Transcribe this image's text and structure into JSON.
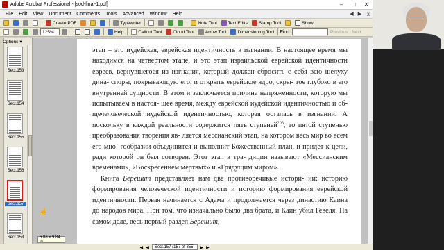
{
  "window": {
    "title": "Adobe Acrobat Professional - [sod-final-1.pdf]",
    "minimize": "–",
    "maximize": "□",
    "close": "✕"
  },
  "menubar": {
    "items": [
      "File",
      "Edit",
      "View",
      "Document",
      "Comments",
      "Tools",
      "Advanced",
      "Window",
      "Help"
    ],
    "close": "x"
  },
  "toolbar1": {
    "create_pdf": "Create PDF",
    "typewriter": "Typewriter",
    "note_tool": "Note Tool",
    "text_edits": "Text Edits",
    "stamp_tool": "Stamp Tool",
    "show": "Show"
  },
  "toolbar2": {
    "zoom": "125%",
    "help": "Help",
    "callout_tool": "Callout Tool",
    "cloud_tool": "Cloud Tool",
    "arrow_tool": "Arrow Tool",
    "dimensioning_tool": "Dimensioning Tool",
    "find_label": "Find:",
    "previous": "Previous",
    "next": "Next"
  },
  "sidebar": {
    "options": "Options",
    "thumbnails": [
      {
        "label": "Sect.153",
        "selected": false
      },
      {
        "label": "Sect.154",
        "selected": false
      },
      {
        "label": "Sect.155",
        "selected": false
      },
      {
        "label": "Sect.156",
        "selected": false
      },
      {
        "label": "Sect.157",
        "selected": true
      },
      {
        "label": "Sect.158",
        "selected": false
      }
    ]
  },
  "document": {
    "paragraph1": [
      "этап – это иудейская, еврейская идентичность в изгнании. В",
      "настоящее время мы находимся на четвертом этапе, и это этап",
      "израильской еврейской идентичности евреев, вернувшегося из",
      "изгнания, который должен сбросить с себя всю шелуху дина-",
      "споры, покрывающую его, и открыть еврейское ядро, скры-",
      "тое глубоко в его внутренней сущности. В этом и заключается",
      "причина напряженности, которую мы испытываем в настоя-",
      "щее время, между еврейской иудейской идентичностью и об-",
      "щечеловеческой иудейской идентичностью, которая осталась",
      "в изгнании. А поскольку в каждой реальности содержится пять"
    ],
    "p1_line11_before": "ступеней",
    "footnote_ref": "206",
    "p1_line11_after": ", то пятой ступенью преобразования творения яв-",
    "paragraph1_tail": [
      "ляется мессианский этап, на котором весь мир во всем его мно-",
      "гообразии объединится и выполнит Божественный план, и",
      "придет к цели, ради которой он был сотворен. Этот этап в тра-",
      "диции называют «Мессианским временами», «Воскресением",
      "мертвых» и «Грядущим миром»."
    ],
    "p2_line1_before": "Книга ",
    "p2_line1_italic": "Берешит",
    "p2_line1_after": " представляет нам две противоречивые истори-",
    "paragraph2": [
      "ии: историю формирования человеческой идентичности и",
      "историю формирования еврейской идентичности. Первая",
      "начинается с Адама и продолжается через династию Каина",
      "до народов мира. При том, что изначально было два брата, и"
    ],
    "p2_last_before": "Каин убил Гевеля. На самом деле, весь первый раздел ",
    "p2_last_italic": "Берешит",
    "p2_last_after": ","
  },
  "statusbar": {
    "page_size": "6.88 x 9.84 in",
    "first": "|◀",
    "prev": "◀",
    "page_info": "Sect.157 (157 of 355)",
    "next": "▶",
    "last": "▶|"
  },
  "colors": {
    "selection_red": "#d91b1b",
    "selection_blue": "#3169c6",
    "toolbar_bg": "#ece9d8"
  }
}
